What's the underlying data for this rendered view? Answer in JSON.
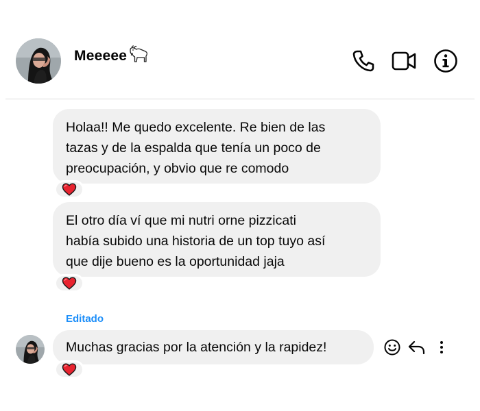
{
  "header": {
    "contact_name": "Meeeee",
    "contact_emoji": "goat-emoji",
    "actions": {
      "call": "phone-icon",
      "video": "video-camera-icon",
      "info": "info-icon"
    }
  },
  "messages": [
    {
      "text": "Holaa!! Me quedo excelente. Re bien de las tazas y de la espalda que tenía un poco de preocupación, y obvio que re comodo",
      "lines": [
        "Holaa!! Me quedo excelente. Re bien de las",
        "tazas y de la espalda que tenía un poco de",
        "preocupación, y obvio que re comodo"
      ],
      "reaction": "red-heart"
    },
    {
      "text": "El otro día ví que mi nutri orne pizzicati había subido una historia de un top tuyo así que dije bueno es la oportunidad jaja",
      "lines": [
        "El otro día ví que mi nutri orne pizzicati",
        "había subido una historia de un top tuyo así",
        "que dije bueno es la oportunidad jaja"
      ],
      "reaction": "red-heart"
    },
    {
      "edited_label": "Editado",
      "text": "Muchas gracias por la atención y la rapidez!",
      "lines": [
        "Muchas gracias por la atención y la rapidez!"
      ],
      "reaction": "red-heart",
      "actions": [
        "smiley-icon",
        "reply-icon",
        "more-vertical-icon"
      ]
    }
  ],
  "colors": {
    "bubble_bg": "#f0f0f0",
    "edited_blue": "#1c8ef9",
    "heart_red": "#e8232f"
  }
}
